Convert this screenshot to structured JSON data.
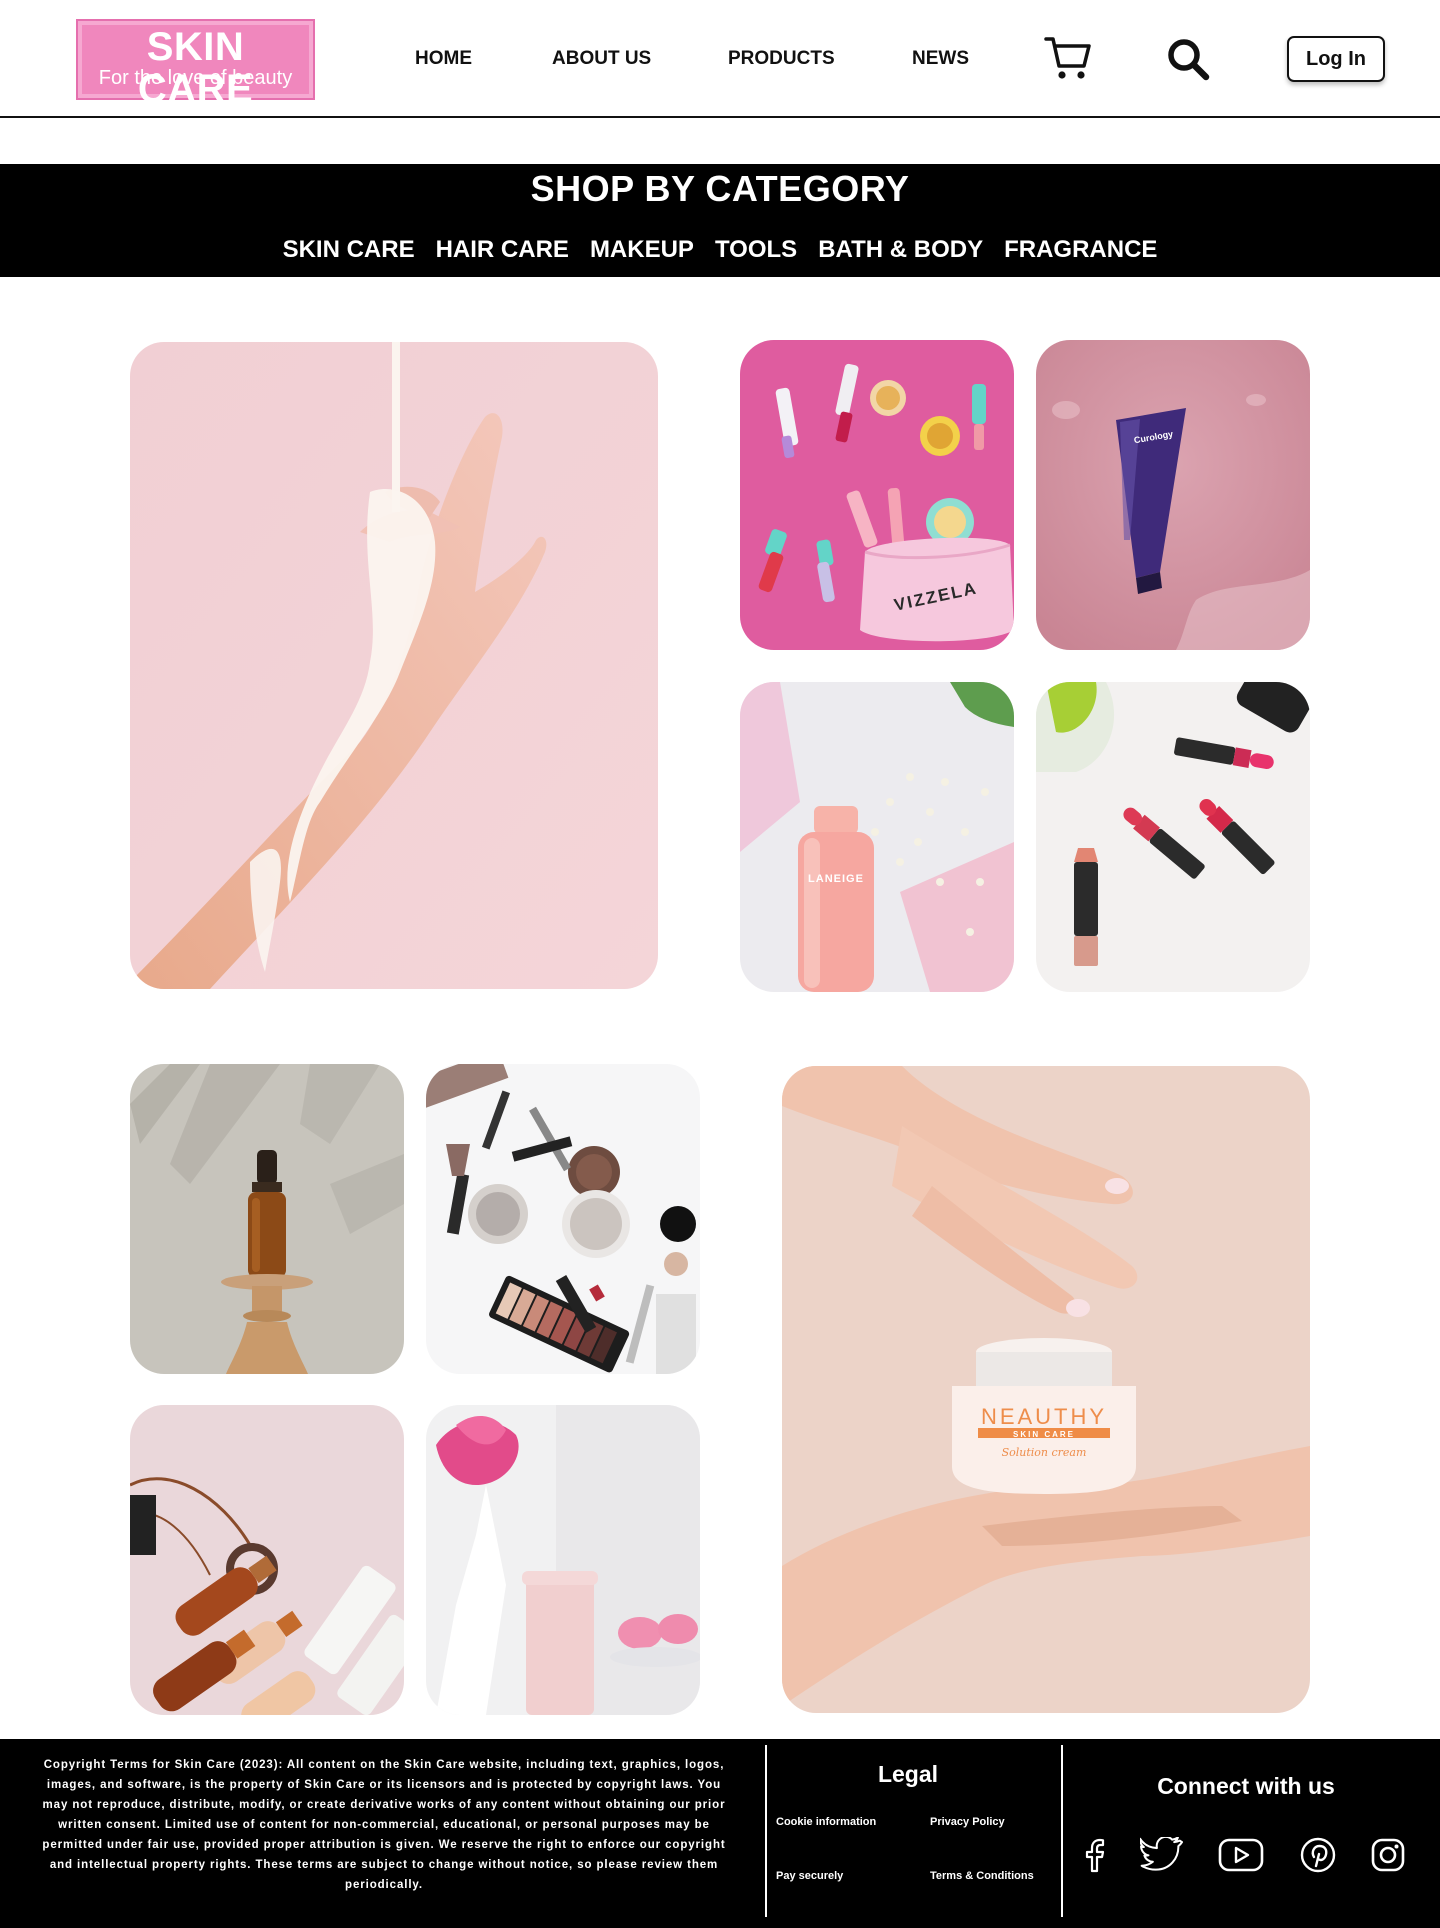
{
  "brand": {
    "name": "SKIN CARE",
    "tagline": "For the love of beauty",
    "color": "#f087bd"
  },
  "nav": {
    "items": [
      {
        "label": "HOME"
      },
      {
        "label": "ABOUT US"
      },
      {
        "label": "PRODUCTS"
      },
      {
        "label": "NEWS"
      }
    ],
    "cart_icon": "shopping-cart-icon",
    "search_icon": "magnifier-icon",
    "login_label": "Log In"
  },
  "category": {
    "title": "SHOP BY CATEGORY",
    "items": [
      {
        "label": "SKIN CARE"
      },
      {
        "label": "HAIR CARE"
      },
      {
        "label": "MAKEUP"
      },
      {
        "label": "TOOLS"
      },
      {
        "label": "BATH & BODY"
      },
      {
        "label": "FRAGRANCE"
      }
    ]
  },
  "gallery": {
    "photos": [
      {
        "subject": "hand-with-lotion"
      },
      {
        "subject": "vizzela-makeup-bag",
        "label": "VIZZELA"
      },
      {
        "subject": "curology-tube-in-water",
        "label": "Curology"
      },
      {
        "subject": "laneige-toner-bottle",
        "label": "LANEIGE"
      },
      {
        "subject": "lipsticks"
      },
      {
        "subject": "amber-dropper-bottle"
      },
      {
        "subject": "makeup-flatlay"
      },
      {
        "subject": "copper-bottles"
      },
      {
        "subject": "pink-tube-with-roses"
      },
      {
        "subject": "neauthy-cream-jar",
        "label": "NEAUTHY",
        "sublabel": "SKIN CARE",
        "script": "Solution cream"
      }
    ]
  },
  "footer": {
    "copyright": "Copyright Terms for Skin Care (2023): All content on the Skin Care website, including text, graphics, logos, images, and software, is the property of Skin Care or its licensors and is protected by copyright laws. You may not reproduce, distribute, modify, or create derivative works of any content without obtaining our prior written consent. Limited use of content for non-commercial, educational, or personal purposes may be permitted under fair use, provided proper attribution is given. We reserve the right to enforce our copyright and intellectual property rights. These terms are subject to change without notice, so please review them periodically.",
    "legal": {
      "title": "Legal",
      "links": [
        {
          "label": "Cookie information"
        },
        {
          "label": "Privacy  Policy"
        },
        {
          "label": "Pay securely"
        },
        {
          "label": "Terms & Conditions"
        }
      ]
    },
    "connect": {
      "title": "Connect with us",
      "icons": [
        "facebook-icon",
        "twitter-icon",
        "youtube-icon",
        "pinterest-icon",
        "instagram-icon"
      ]
    }
  }
}
